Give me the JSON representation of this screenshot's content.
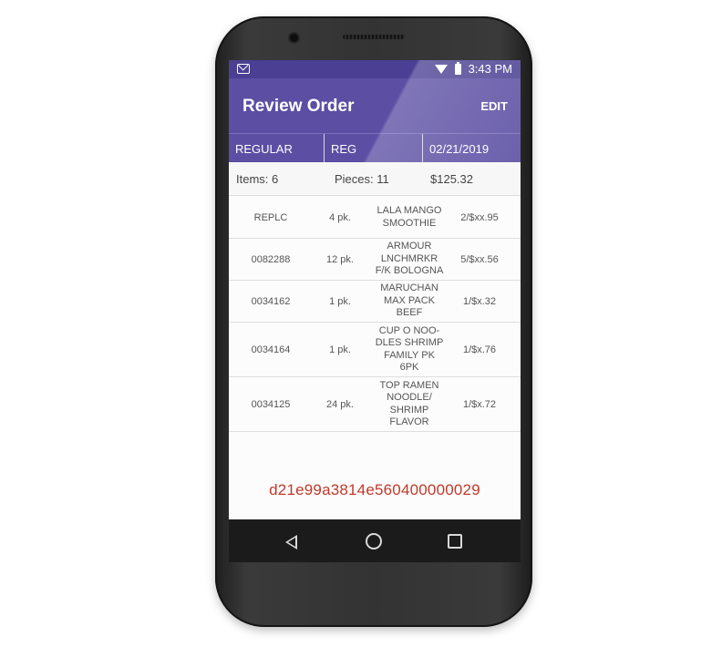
{
  "status_bar": {
    "notification_icon": "gmail-icon",
    "wifi_icon": "wifi-icon",
    "battery_icon": "battery-icon",
    "time": "3:43 PM"
  },
  "app_bar": {
    "title": "Review Order",
    "edit_label": "EDIT"
  },
  "order_info": {
    "type": "REGULAR",
    "code": "REG",
    "date": "02/21/2019"
  },
  "summary": {
    "items": "Items: 6",
    "pieces": "Pieces: 11",
    "total": "$125.32"
  },
  "rows": [
    {
      "code": "REPLC",
      "pack": "4 pk.",
      "desc": "LALA MANGO\nSMOOTHIE",
      "price": "2/$xx.95"
    },
    {
      "code": "0082288",
      "pack": "12 pk.",
      "desc": "ARMOUR\nLNCHMRKR\nF/K BOLOGNA",
      "price": "5/$xx.56"
    },
    {
      "code": "0034162",
      "pack": "1 pk.",
      "desc": "MARUCHAN\nMAX PACK\nBEEF",
      "price": "1/$x.32"
    },
    {
      "code": "0034164",
      "pack": "1 pk.",
      "desc": "CUP O NOO-\nDLES SHRIMP\nFAMILY PK\n6PK",
      "price": "1/$x.76"
    },
    {
      "code": "0034125",
      "pack": "24 pk.",
      "desc": "TOP RAMEN\nNOODLE/\nSHRIMP\nFLAVOR",
      "price": "1/$x.72"
    }
  ],
  "order_id": "d21e99a3814e560400000029",
  "nav_bar": {
    "back_icon": "back-triangle-icon",
    "home_icon": "home-circle-icon",
    "recent_icon": "recent-apps-square-icon"
  },
  "colors": {
    "app_bar": "#5b4ea3",
    "status_bar": "#4a3f92",
    "order_id": "#c0392b",
    "nav_bar": "#1b1b1b"
  }
}
